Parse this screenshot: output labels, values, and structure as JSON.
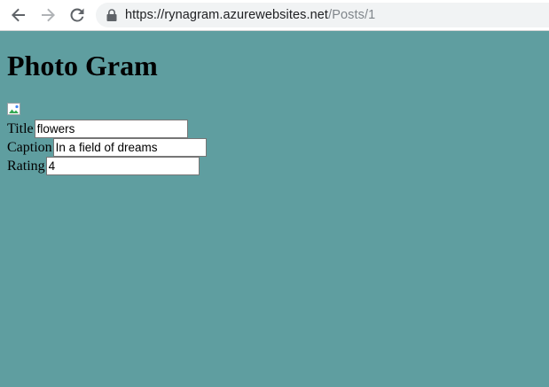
{
  "browser": {
    "url_host": "https://rynagram.azurewebsites.net",
    "url_path": "/Posts/1",
    "icons": {
      "back": "arrow-back-icon",
      "forward": "arrow-forward-icon",
      "reload": "reload-icon",
      "secure": "lock-icon"
    }
  },
  "page": {
    "heading": "Photo Gram",
    "background_color": "#5f9ea0",
    "fields": {
      "title": {
        "label": "Title",
        "value": "flowers"
      },
      "caption": {
        "label": "Caption",
        "value": "In a field of dreams"
      },
      "rating": {
        "label": "Rating",
        "value": "4"
      }
    }
  }
}
